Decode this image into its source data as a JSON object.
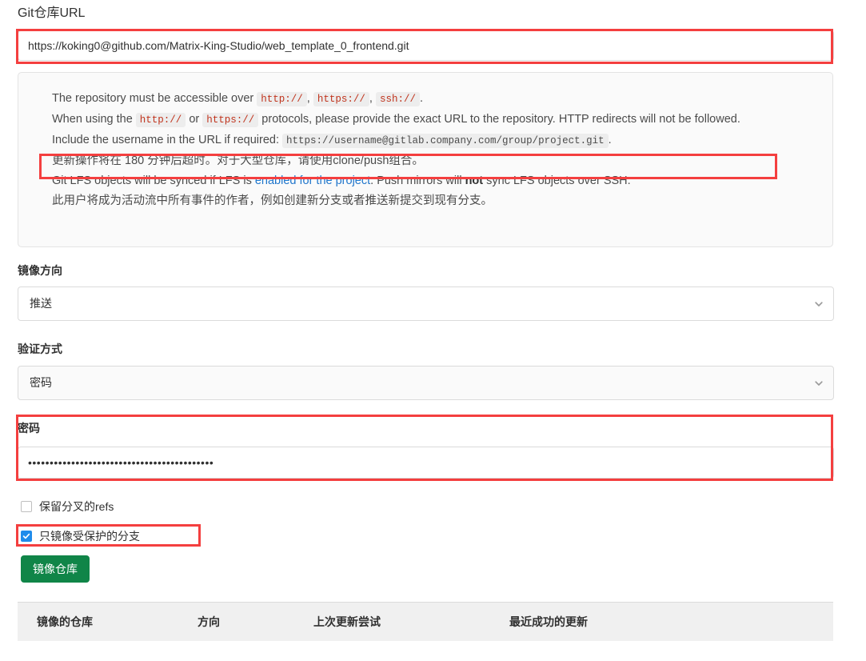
{
  "repo_url_section": {
    "label": "Git仓库URL",
    "value": "https://koking0@github.com/Matrix-King-Studio/web_template_0_frontend.git"
  },
  "info_panel": {
    "line1": {
      "part1": "The repository must be accessible over ",
      "code1": "http://",
      "sep1": ", ",
      "code2": "https://",
      "sep2": ", ",
      "code3": "ssh://",
      "end": "."
    },
    "line2": {
      "part1": "When using the ",
      "code1": "http://",
      "mid": " or ",
      "code2": "https://",
      "part2": " protocols, please provide the exact URL to the repository. HTTP redirects will not be followed."
    },
    "line3": {
      "part1": "Include the username in the URL if required: ",
      "code1": "https://username@gitlab.company.com/group/project.git",
      "end": "."
    },
    "line4": "更新操作将在 180 分钟后超时。对于大型仓库，请使用clone/push组合。",
    "line5": {
      "part1": "Git LFS objects will be synced if LFS is ",
      "link": "enabled for the project",
      "part2": ". Push mirrors will ",
      "bold": "not",
      "part3": " sync LFS objects over SSH."
    },
    "line6": "此用户将成为活动流中所有事件的作者，例如创建新分支或者推送新提交到现有分支。"
  },
  "direction_section": {
    "label": "镜像方向",
    "value": "推送",
    "chevron": "chevron-down-icon"
  },
  "auth_section": {
    "label": "验证方式",
    "value": "密码",
    "chevron": "chevron-down-icon"
  },
  "password_section": {
    "label": "密码",
    "value": "•••••••••••••••••••••••••••••••••••••••••••"
  },
  "checkboxes": [
    {
      "label": "保留分叉的refs",
      "checked": false
    },
    {
      "label": "只镜像受保护的分支",
      "checked": true
    }
  ],
  "mirror_button": {
    "label": "镜像仓库"
  },
  "table": {
    "headers": [
      "镜像的仓库",
      "方向",
      "上次更新尝试",
      "最近成功的更新"
    ]
  },
  "colors": {
    "annotation": "#f43f3f",
    "button_green": "#108548",
    "link_blue": "#1f75cb",
    "checkbox_blue": "#1f8ceb",
    "code_red": "#c0341d"
  }
}
